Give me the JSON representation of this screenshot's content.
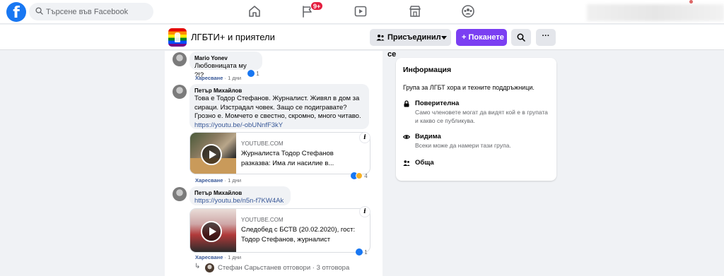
{
  "topbar": {
    "logo": "f",
    "search_placeholder": "Търсене във Facebook",
    "notification_count": "9+",
    "nav_icons": [
      "home-icon",
      "flag-icon",
      "watch-icon",
      "marketplace-icon",
      "groups-icon"
    ]
  },
  "group": {
    "name": "ЛГБТИ+ и приятели",
    "joined_label": "Присъединил се",
    "invite_label": "+ Поканете",
    "search_icon": "search-icon",
    "more_label": "···"
  },
  "comments": [
    {
      "author": "Mario Yonev",
      "text": "Любовницата му ?!?",
      "like_label": "Харесване",
      "time": "· 1 дни",
      "reactions": "1"
    },
    {
      "author": "Петър Михайлов",
      "lines": [
        "Това е Тодор Стефанов. Журналист. Живял в дом за",
        "сираци. Изстрадал човек. Защо се подигравате?",
        "Грозно е. Момчето е свестно, скромно, много читаво."
      ],
      "link": "https://youtu.be/-obUNnfF3kY",
      "card": {
        "domain": "YOUTUBE.COM",
        "title_lines": [
          "Журналиста Тодор Стефанов",
          "разказва: Има ли насилие в..."
        ]
      },
      "like_label": "Харесване",
      "time": "· 1 дни",
      "reactions": "4"
    },
    {
      "author": "Петър Михайлов",
      "link": "https://youtu.be/n5n-f7KW4Ak",
      "card": {
        "domain": "YOUTUBE.COM",
        "title_lines": [
          "Следобед с БСТВ (20.02.2020), гост:",
          "Тодор Стефанов, журналист"
        ]
      },
      "like_label": "Харесване",
      "time": "· 1 дни",
      "reactions": "1"
    }
  ],
  "reply_summary": "Стефан Сарьстанев отговори · 3 отговора",
  "info": {
    "title": "Информация",
    "description": "Група за ЛГБТ хора и техните поддръжници.",
    "privacy_title": "Поверителна",
    "privacy_sub": "Само членовете могат да видят кой е в групата и какво се публикува.",
    "visibility_title": "Видима",
    "visibility_sub": "Всеки може да намери тази група.",
    "general_title": "Обща"
  },
  "colors": {
    "brand": "#1877f2",
    "invite": "#7b3ff2",
    "badge": "#e41e3f",
    "link": "#385898"
  }
}
